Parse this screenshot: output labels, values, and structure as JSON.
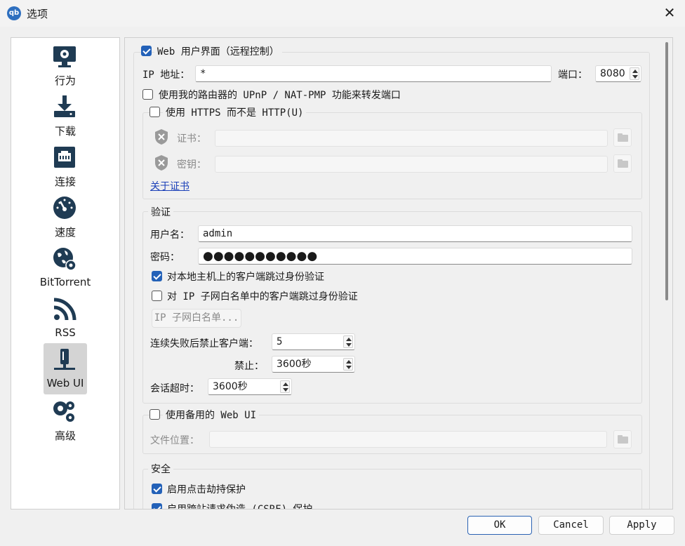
{
  "window": {
    "title": "选项",
    "app_icon_text": "qb"
  },
  "sidebar": {
    "items": [
      {
        "label": "行为",
        "icon": "gear-monitor-icon"
      },
      {
        "label": "下载",
        "icon": "download-icon"
      },
      {
        "label": "连接",
        "icon": "network-port-icon"
      },
      {
        "label": "速度",
        "icon": "speedometer-icon"
      },
      {
        "label": "BitTorrent",
        "icon": "globe-gear-icon"
      },
      {
        "label": "RSS",
        "icon": "rss-icon"
      },
      {
        "label": "Web UI",
        "icon": "webui-icon"
      },
      {
        "label": "高级",
        "icon": "gears-icon"
      }
    ],
    "selected": "Web UI"
  },
  "webui": {
    "group_label": "Web 用户界面（远程控制）",
    "enabled": true,
    "ip_label": "IP 地址：",
    "ip_value": "*",
    "port_label": "端口：",
    "port_value": "8080",
    "upnp_label": "使用我的路由器的 UPnP / NAT-PMP 功能来转发端口",
    "upnp_checked": false,
    "https": {
      "label": "使用 HTTPS 而不是 HTTP(U)",
      "checked": false,
      "cert_label": "证书：",
      "key_label": "密钥：",
      "about_link": "关于证书"
    },
    "auth": {
      "title": "验证",
      "username_label": "用户名：",
      "username_value": "admin",
      "password_label": "密码：",
      "password_value": "●●●●●●●●●●●",
      "bypass_local_label": "对本地主机上的客户端跳过身份验证",
      "bypass_local_checked": true,
      "bypass_subnet_label": "对 IP 子网白名单中的客户端跳过身份验证",
      "bypass_subnet_checked": false,
      "whitelist_button": "IP 子网白名单...",
      "ban_after_label": "连续失败后禁止客户端：",
      "ban_after_value": "5",
      "ban_label": "禁止：",
      "ban_value": "3600秒",
      "session_label": "会话超时：",
      "session_value": "3600秒"
    },
    "alt_ui": {
      "label": "使用备用的 Web UI",
      "checked": false,
      "file_label": "文件位置："
    },
    "security": {
      "title": "安全",
      "clickjack_label": "启用点击劫持保护",
      "clickjack_checked": true,
      "csrf_label": "启用跨站请求伪造 (CSRF) 保护",
      "csrf_checked": true
    }
  },
  "footer": {
    "ok": "OK",
    "cancel": "Cancel",
    "apply": "Apply"
  },
  "colors": {
    "accent": "#2361b8",
    "link": "#1a3fb8"
  }
}
